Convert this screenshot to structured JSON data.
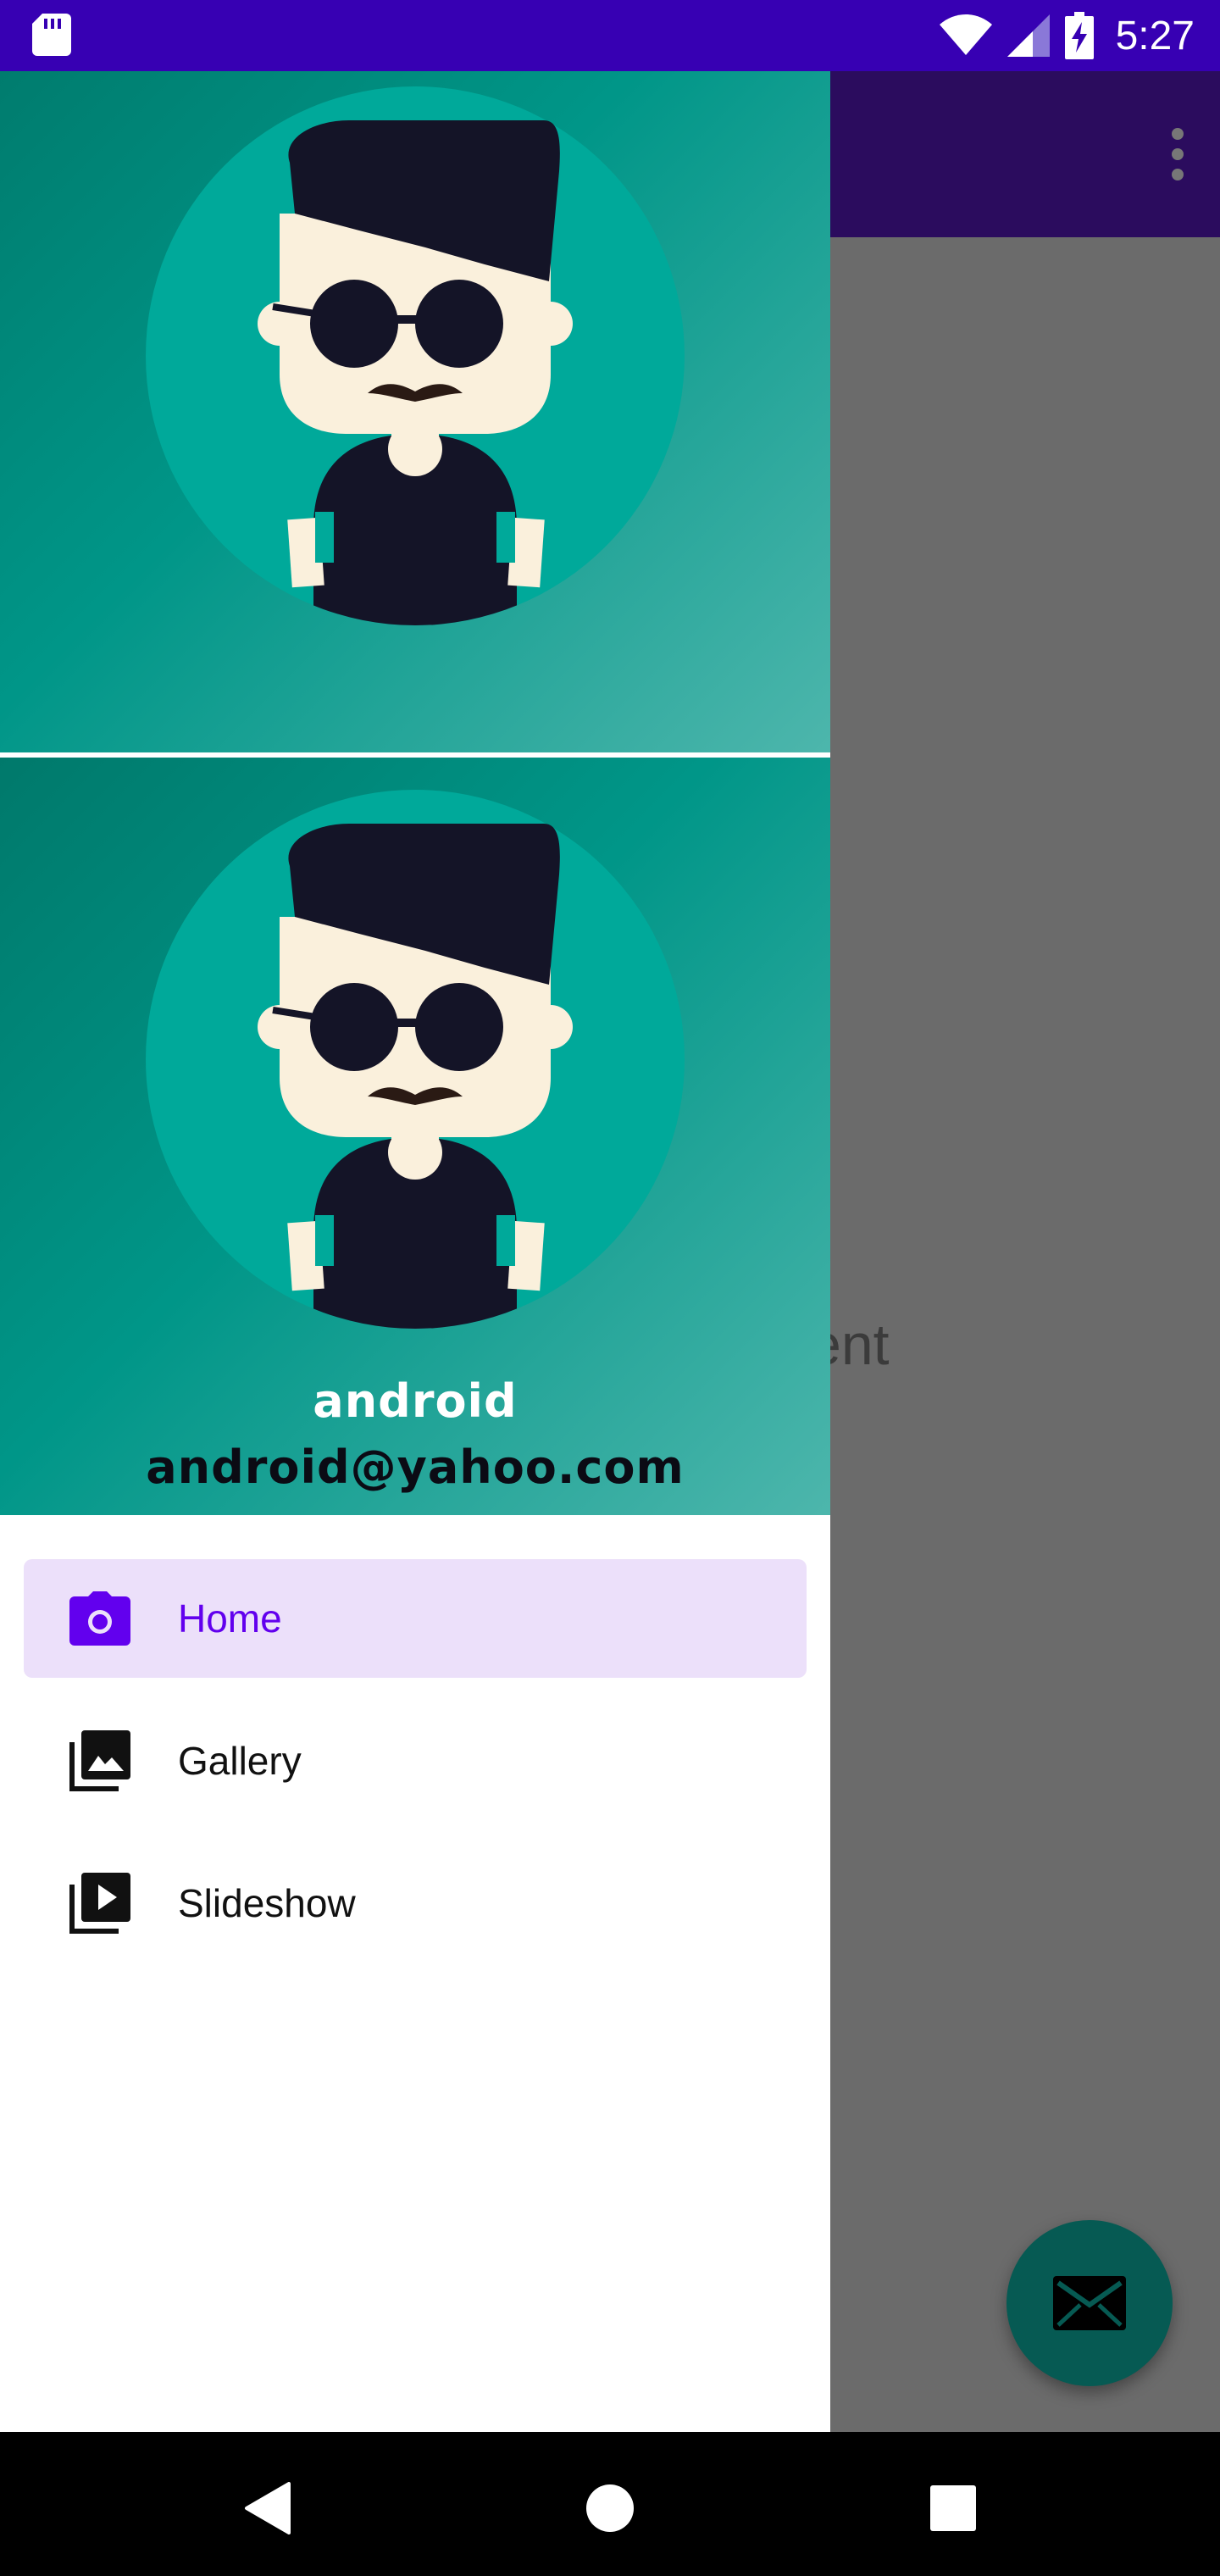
{
  "status_bar": {
    "time": "5:27",
    "icons": [
      "sd-card-icon",
      "wifi-icon",
      "cellular-signal-icon",
      "battery-charging-icon"
    ]
  },
  "background_app": {
    "content_text": "ent",
    "fab_icon": "email-icon"
  },
  "drawer": {
    "header": {
      "name": "android",
      "email": "android@yahoo.com",
      "avatar_icon": "avatar-icon"
    },
    "menu": [
      {
        "label": "Home",
        "icon": "camera-icon",
        "active": true
      },
      {
        "label": "Gallery",
        "icon": "gallery-icon",
        "active": false
      },
      {
        "label": "Slideshow",
        "icon": "slideshow-icon",
        "active": false
      }
    ]
  },
  "colors": {
    "status_bar": "#3700b3",
    "primary": "#6200ee",
    "active_item_bg": "#ece0fa",
    "header_teal": "#009688",
    "scrim": "#6b6b6b",
    "fab": "#065a53"
  },
  "nav_bar": {
    "buttons": [
      "back-icon",
      "home-icon",
      "recents-icon"
    ]
  }
}
